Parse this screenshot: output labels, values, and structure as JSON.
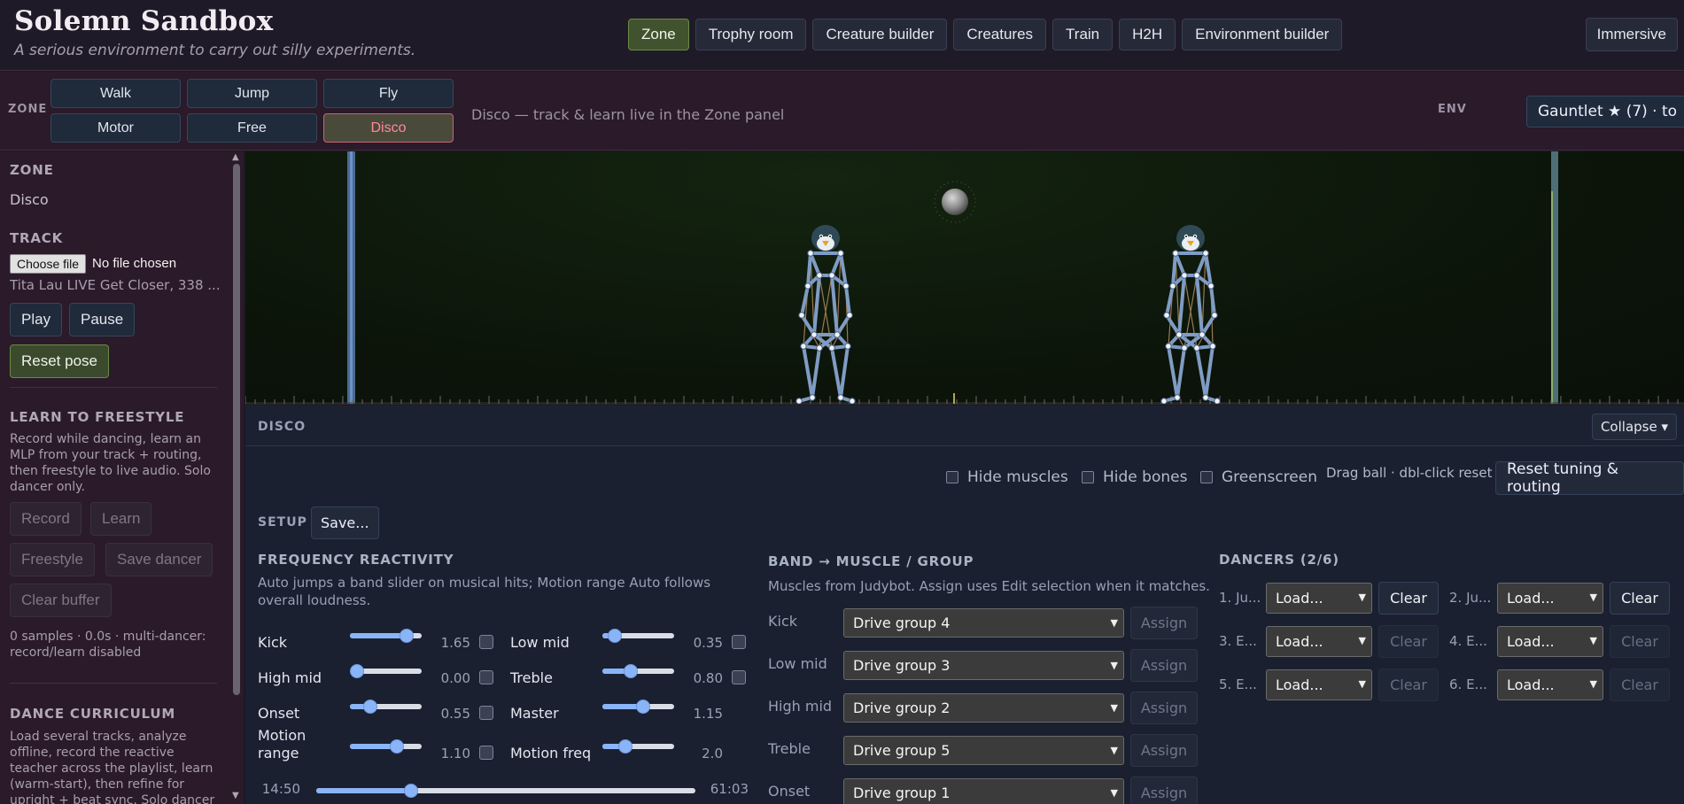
{
  "app": {
    "title": "Solemn Sandbox",
    "subtitle": "A serious environment to carry out silly experiments."
  },
  "nav": {
    "tabs": [
      "Zone",
      "Trophy room",
      "Creature builder",
      "Creatures",
      "Train",
      "H2H",
      "Environment builder"
    ],
    "active": "Zone",
    "immersive": "Immersive"
  },
  "zone_bar": {
    "label": "ZONE",
    "modes": [
      "Walk",
      "Jump",
      "Fly",
      "Motor",
      "Free",
      "Disco"
    ],
    "active_mode": "Disco",
    "hint": "Disco — track & learn live in the Zone panel",
    "env_label": "ENV",
    "env_value": "Gauntlet ★ (7) · to"
  },
  "sidebar": {
    "zone_heading": "ZONE",
    "zone_value": "Disco",
    "track_heading": "TRACK",
    "file_button": "Choose file",
    "file_status": "No file chosen",
    "track_name": "Tita Lau LIVE Get Closer, 338 ...",
    "play": "Play",
    "pause": "Pause",
    "reset_pose": "Reset pose",
    "freestyle_heading": "LEARN TO FREESTYLE",
    "freestyle_desc": "Record while dancing, learn an MLP from your track + routing, then freestyle to live audio. Solo dancer only.",
    "record": "Record",
    "learn": "Learn",
    "freestyle": "Freestyle",
    "save_dancer": "Save dancer",
    "clear_buffer": "Clear buffer",
    "buffer_status": "0 samples · 0.0s · multi-dancer: record/learn disabled",
    "curriculum_heading": "DANCE CURRICULUM",
    "curriculum_desc": "Load several tracks, analyze offline, record the reactive teacher across the playlist, learn (warm-start), then refine for upright + beat sync. Solo dancer only. Does not change"
  },
  "panel": {
    "title": "DISCO",
    "collapse": "Collapse ▾",
    "hide_muscles": "Hide muscles",
    "hide_bones": "Hide bones",
    "greenscreen": "Greenscreen",
    "drag_hint": "Drag ball · dbl-click reset",
    "reset_tuning": "Reset tuning & routing",
    "setup_label": "SETUP",
    "save": "Save...",
    "freq": {
      "heading": "FREQUENCY REACTIVITY",
      "desc": "Auto jumps a band slider on musical hits; Motion range Auto follows overall loudness.",
      "kick_label": "Kick",
      "kick_value": "1.65",
      "kick_level": 0.79,
      "lowmid_label": "Low mid",
      "lowmid_value": "0.35",
      "lowmid_level": 0.17,
      "highmid_label": "High mid",
      "highmid_value": "0.00",
      "highmid_level": 0.0,
      "treble_label": "Treble",
      "treble_value": "0.80",
      "treble_level": 0.4,
      "onset_label": "Onset",
      "onset_value": "0.55",
      "onset_level": 0.28,
      "master_label": "Master",
      "master_value": "1.15",
      "master_level": 0.57,
      "motionrange_label": "Motion range",
      "motionrange_value": "1.10",
      "motionrange_level": 0.66,
      "motionfreq_label": "Motion freq",
      "motionfreq_value": "2.0",
      "motionfreq_level": 0.32,
      "time_start": "14:50",
      "time_end": "61:03",
      "time_level": 0.25
    },
    "band": {
      "heading": "BAND → MUSCLE / GROUP",
      "desc": "Muscles from Judybot. Assign uses Edit selection when it matches.",
      "assign": "Assign",
      "rows": [
        {
          "band": "Kick",
          "group": "Drive group 4"
        },
        {
          "band": "Low mid",
          "group": "Drive group 3"
        },
        {
          "band": "High mid",
          "group": "Drive group 2"
        },
        {
          "band": "Treble",
          "group": "Drive group 5"
        },
        {
          "band": "Onset",
          "group": "Drive group 1"
        }
      ]
    },
    "dancers": {
      "heading": "DANCERS (2/6)",
      "load": "Load...",
      "clear": "Clear",
      "slots": [
        "1. Ju...",
        "2. Ju...",
        "3. E...",
        "4. E...",
        "5. E...",
        "6. E..."
      ]
    }
  }
}
